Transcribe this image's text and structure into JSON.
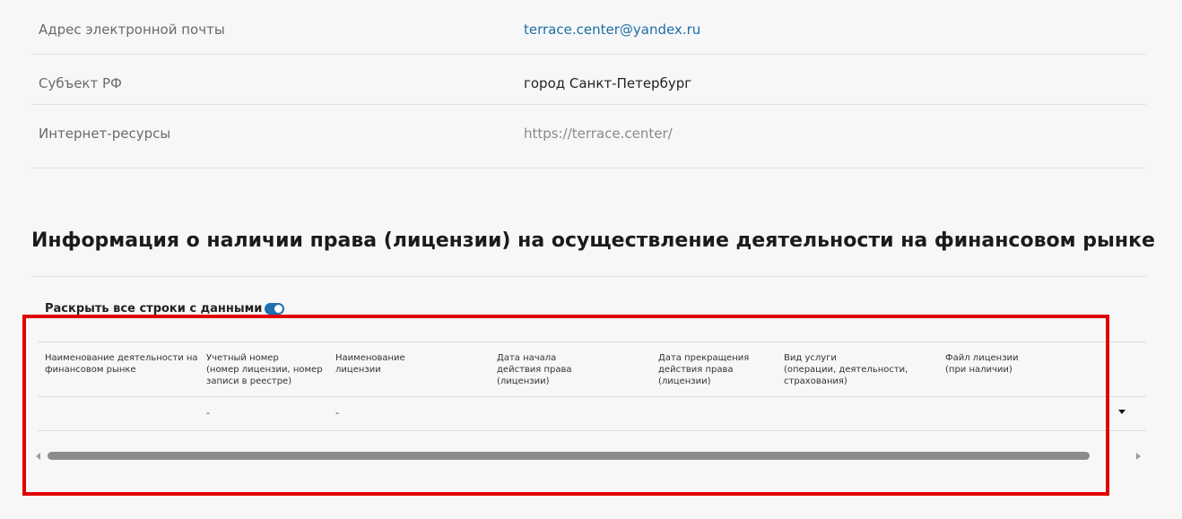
{
  "contact_info": [
    {
      "label": "Адрес электронной почты",
      "value": "terrace.center@yandex.ru"
    },
    {
      "label": "Субъект РФ",
      "value": "город Санкт-Петербург"
    },
    {
      "label": "Интернет-ресурсы",
      "value": "https://terrace.center/"
    }
  ],
  "license_section": {
    "title": "Информация о наличии права (лицензии) на осуществление деятельности на финансовом рынке",
    "expand_all_label": "Раскрыть все строки с данными",
    "expand_all_enabled": true,
    "columns": [
      "Наименование деятельности на\nфинансовом рынке",
      "Учетный номер\n(номер лицензии, номер\nзаписи в реестре)",
      "Наименование\nлицензии",
      "Дата начала\nдействия права\n(лицензии)",
      "Дата прекращения\nдействия права\n(лицензии)",
      "Вид услуги\n(операции, деятельности,\nстрахования)",
      "Файл лицензии\n(при наличии)"
    ],
    "rows": [
      [
        "",
        "-",
        "-",
        "",
        "",
        "",
        ""
      ]
    ]
  },
  "colors": {
    "link": "#1d6fa5",
    "toggle": "#1f6fb0",
    "highlight": "#e00000"
  },
  "icons": {
    "expand_row": "caret-down-icon",
    "scroll_left": "arrow-left-icon",
    "scroll_right": "arrow-right-icon"
  }
}
